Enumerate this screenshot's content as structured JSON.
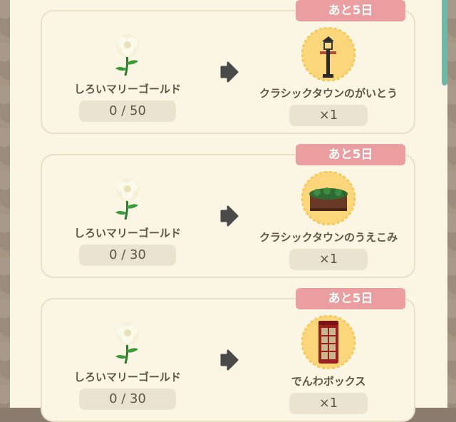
{
  "cards": [
    {
      "deadline": "あと5日",
      "input_name": "しろいマリーゴールド",
      "input_progress": "0 / 50",
      "reward_name": "クラシックタウンのがいとう",
      "reward_qty": "×1",
      "input_icon": "white-marigold-icon",
      "reward_icon": "street-lamp-icon"
    },
    {
      "deadline": "あと5日",
      "input_name": "しろいマリーゴールド",
      "input_progress": "0 / 30",
      "reward_name": "クラシックタウンのうえこみ",
      "reward_qty": "×1",
      "input_icon": "white-marigold-icon",
      "reward_icon": "hedge-planter-icon"
    },
    {
      "deadline": "あと5日",
      "input_name": "しろいマリーゴールド",
      "input_progress": "0 / 30",
      "reward_name": "でんわボックス",
      "reward_qty": "×1",
      "input_icon": "white-marigold-icon",
      "reward_icon": "phone-booth-icon"
    }
  ],
  "colors": {
    "badge": "#ea9ea0",
    "panel": "#fbf6e4",
    "pill": "#eae3cf",
    "text": "#5e5447",
    "sunburst": "#fbd67a"
  }
}
